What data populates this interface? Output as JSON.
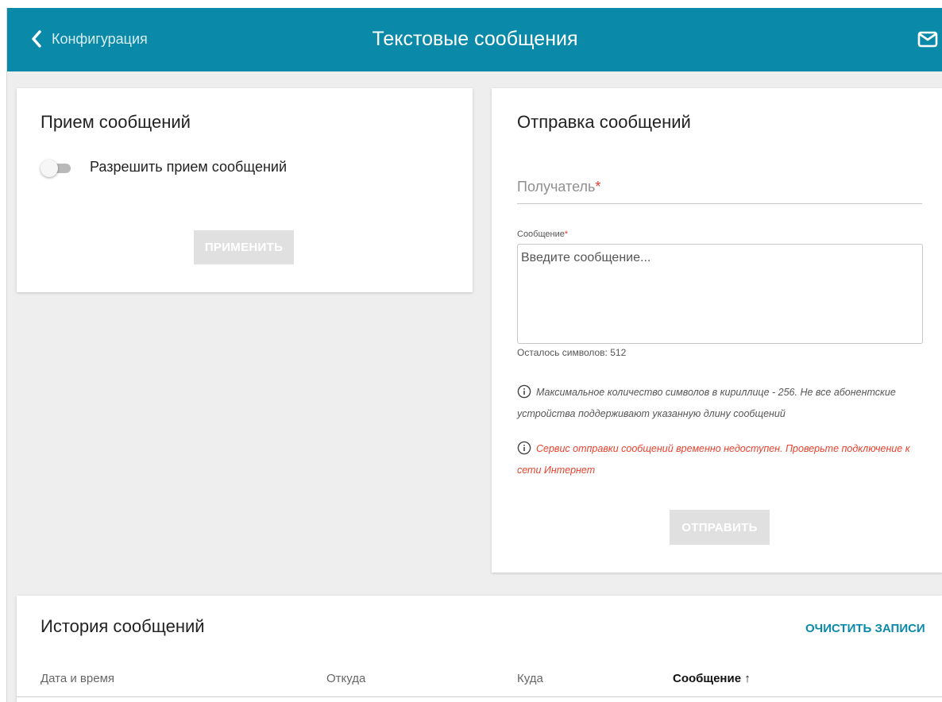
{
  "header": {
    "back_label": "Конфигурация",
    "title": "Текстовые сообщения",
    "back_icon": "chevron-left-icon",
    "mail_icon": "mail-icon",
    "color": "#0a8aa8"
  },
  "receive": {
    "title": "Прием сообщений",
    "toggle_label": "Разрешить прием сообщений",
    "toggle_on": false,
    "apply_label": "ПРИМЕНИТЬ"
  },
  "send": {
    "title": "Отправка сообщений",
    "recipient_label": "Получатель",
    "required_mark": "*",
    "message_label": "Сообщение",
    "message_placeholder": "Введите сообщение...",
    "remaining": "Осталось символов: 512",
    "note_limit": "Максимальное количество символов в кириллице - 256. Не все абонентские устройства поддерживают указанную длину сообщений",
    "note_error": "Сервис отправки сообщений временно недоступен. Проверьте подключение к сети Интернет",
    "send_label": "ОТПРАВИТЬ",
    "error_color": "#e8412d"
  },
  "history": {
    "title": "История сообщений",
    "clear_label": "ОЧИСТИТЬ ЗАПИСИ",
    "columns": [
      "Дата и время",
      "Откуда",
      "Куда",
      "Сообщение ↑"
    ]
  }
}
